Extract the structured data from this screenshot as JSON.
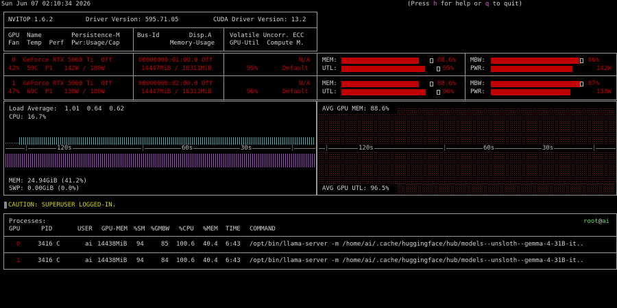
{
  "topbar": {
    "datetime": "Sun Jun 07 02:10:34 2026",
    "help_prefix": "(Press ",
    "help_key_h": "h",
    "help_mid": " for help or ",
    "help_key_q": "q",
    "help_suffix": " to quit)"
  },
  "header": {
    "nvitop": "NVITOP 1.6.2",
    "driver": "Driver Version: 595.71.05",
    "cuda": "CUDA Driver Version: 13.2",
    "col1_line1": "GPU  Name        Persistence-M",
    "col1_line2": "Fan  Temp  Perf  Pwr:Usage/Cap",
    "col2_line1": "Bus-Id        Disp.A",
    "col2_line2": "Memory-Usage",
    "col3_line1": "Volatile Uncorr. ECC",
    "col3_line2": "GPU-Util  Compute M."
  },
  "gpus": [
    {
      "line1_a": " 0  GeForce RTX 5060 Ti  Off",
      "line2_a": "42%  59C  P1   142W / 180W",
      "bus": "00000000:01:00.0 Off",
      "mem": "14447MiB / 16311MiB",
      "ecc": "N/A",
      "util": "95%",
      "compute": "Default",
      "mem_label": "MEM:",
      "mem_pct": "88.6%",
      "mem_frac": 0.886,
      "utl_label": "UTL:",
      "utl_pct": "95%",
      "utl_frac": 0.95,
      "mbw_label": "MBW:",
      "mbw_pct": "86%",
      "mbw_frac": 0.86,
      "pwr_label": "PWR:",
      "pwr_val": "142W",
      "pwr_frac": 0.79
    },
    {
      "line1_a": " 1  GeForce RTX 5060 Ti  Off",
      "line2_a": "47%  69C  P1   138W / 180W",
      "bus": "00000000:02:00.0 Off",
      "mem": "14447MiB / 16311MiB",
      "ecc": "N/A",
      "util": "96%",
      "compute": "Default",
      "mem_label": "MEM:",
      "mem_pct": "88.6%",
      "mem_frac": 0.886,
      "utl_label": "UTL:",
      "utl_pct": "96%",
      "utl_frac": 0.96,
      "mbw_label": "MBW:",
      "mbw_pct": "87%",
      "mbw_frac": 0.87,
      "pwr_label": "PWR:",
      "pwr_val": "138W",
      "pwr_frac": 0.77
    }
  ],
  "host": {
    "load_label": "Load Average:",
    "load_values": "1.01  0.64  0.62",
    "cpu": "CPU: 16.7%",
    "mem": "MEM: 24.94GiB (41.2%)",
    "swp": "SWP: 0.00GiB (0.0%)",
    "tick_120": "120s",
    "tick_60": "60s",
    "tick_30": "30s"
  },
  "gpu_panel": {
    "avg_mem": "AVG GPU MEM: 88.6%",
    "avg_utl": "AVG GPU UTL: 96.5%",
    "tick_120": "120s",
    "tick_60": "60s",
    "tick_30": "30s"
  },
  "caution": "CAUTION: SUPERUSER LOGGED-IN.",
  "processes": {
    "title": "Processes:",
    "user_host_user": "root",
    "user_host_at": "@",
    "user_host_host": "ai",
    "headers": [
      "GPU",
      "PID",
      "USER",
      "GPU-MEM",
      "%SM",
      "%GMBW",
      "%CPU",
      "%MEM",
      "TIME",
      "COMMAND"
    ],
    "rows": [
      {
        "gpu": "0",
        "pid": "3416 C",
        "user": "ai",
        "gpumem": "14438MiB",
        "sm": "94",
        "gmbw": "85",
        "cpu": "100.6",
        "mem": "40.4",
        "time": "6:43",
        "command": "/opt/bin/llama-server -m /home/ai/.cache/huggingface/hub/models--unsloth--gemma-4-31B-it.."
      },
      {
        "gpu": "1",
        "pid": "3416 C",
        "user": "ai",
        "gpumem": "14438MiB",
        "sm": "94",
        "gmbw": "84",
        "cpu": "100.6",
        "mem": "40.4",
        "time": "6:43",
        "command": "/opt/bin/llama-server -m /home/ai/.cache/huggingface/hub/models--unsloth--gemma-4-31B-it.."
      }
    ]
  },
  "colors": {
    "bar_red": "#c00000",
    "cpu_cyan": "#2fb5b5",
    "mem_magenta": "#b040d0",
    "caution_yellow": "#d7d700",
    "user_green": "#5fd75f"
  }
}
